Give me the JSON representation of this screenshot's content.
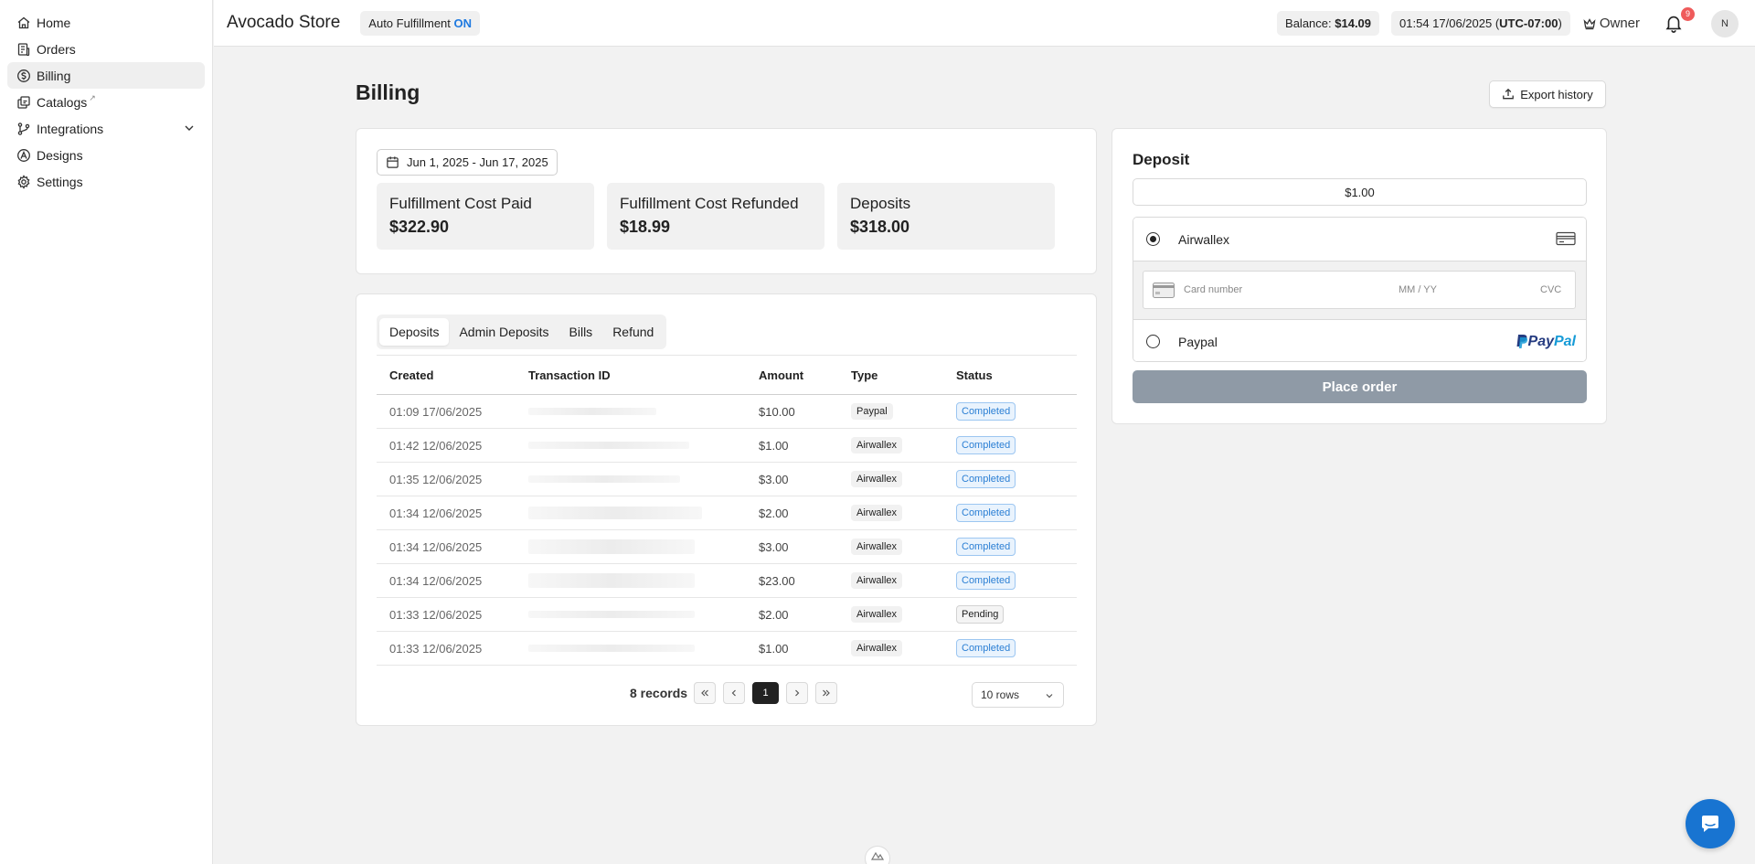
{
  "sidebar": {
    "items": [
      {
        "label": "Home",
        "icon": "home-icon"
      },
      {
        "label": "Orders",
        "icon": "orders-icon"
      },
      {
        "label": "Billing",
        "icon": "dollar-icon",
        "active": true
      },
      {
        "label": "Catalogs",
        "icon": "catalog-icon",
        "external": "↗"
      },
      {
        "label": "Integrations",
        "icon": "integrations-icon"
      },
      {
        "label": "Designs",
        "icon": "designs-icon"
      },
      {
        "label": "Settings",
        "icon": "gear-icon"
      }
    ]
  },
  "header": {
    "store_name": "Avocado Store",
    "auto_fulfillment_label": "Auto Fulfillment",
    "auto_fulfillment_state": "ON",
    "balance_label": "Balance:",
    "balance_value": "$14.09",
    "datetime": "01:54 17/06/2025 (",
    "timezone": "UTC-07:00",
    "datetime_close": ")",
    "role": "Owner",
    "notification_count": "9",
    "avatar_initial": "N"
  },
  "page": {
    "title": "Billing",
    "export_label": "Export history"
  },
  "summary": {
    "date_range": "Jun 1, 2025 - Jun 17, 2025",
    "stats": [
      {
        "label": "Fulfillment Cost Paid",
        "value": "$322.90"
      },
      {
        "label": "Fulfillment Cost Refunded",
        "value": "$18.99"
      },
      {
        "label": "Deposits",
        "value": "$318.00"
      }
    ]
  },
  "transactions": {
    "tabs": [
      "Deposits",
      "Admin Deposits",
      "Bills",
      "Refund"
    ],
    "active_tab": "Deposits",
    "columns": [
      "Created",
      "Transaction ID",
      "Amount",
      "Type",
      "Status"
    ],
    "rows": [
      {
        "created": "01:09 17/06/2025",
        "amount": "$10.00",
        "type": "Paypal",
        "status": "Completed"
      },
      {
        "created": "01:42 12/06/2025",
        "amount": "$1.00",
        "type": "Airwallex",
        "status": "Completed"
      },
      {
        "created": "01:35 12/06/2025",
        "amount": "$3.00",
        "type": "Airwallex",
        "status": "Completed"
      },
      {
        "created": "01:34 12/06/2025",
        "amount": "$2.00",
        "type": "Airwallex",
        "status": "Completed"
      },
      {
        "created": "01:34 12/06/2025",
        "amount": "$3.00",
        "type": "Airwallex",
        "status": "Completed"
      },
      {
        "created": "01:34 12/06/2025",
        "amount": "$23.00",
        "type": "Airwallex",
        "status": "Completed"
      },
      {
        "created": "01:33 12/06/2025",
        "amount": "$2.00",
        "type": "Airwallex",
        "status": "Pending"
      },
      {
        "created": "01:33 12/06/2025",
        "amount": "$1.00",
        "type": "Airwallex",
        "status": "Completed"
      }
    ],
    "records_label": "8 records",
    "current_page": "1",
    "rows_per_page": "10 rows"
  },
  "deposit": {
    "title": "Deposit",
    "amount": "$1.00",
    "methods": [
      {
        "label": "Airwallex",
        "selected": true
      },
      {
        "label": "Paypal",
        "selected": false
      }
    ],
    "card_number_placeholder": "Card number",
    "expiry_placeholder": "MM / YY",
    "cvc_placeholder": "CVC",
    "paypal_logo_1": "Pay",
    "paypal_logo_2": "Pal",
    "place_order_label": "Place order"
  },
  "colors": {
    "accent": "#1f7ae0",
    "completed_text": "#2b7fd4",
    "notification": "#ef5b5b",
    "place_order_disabled": "#8f9aa6",
    "chat": "#1874d1"
  }
}
